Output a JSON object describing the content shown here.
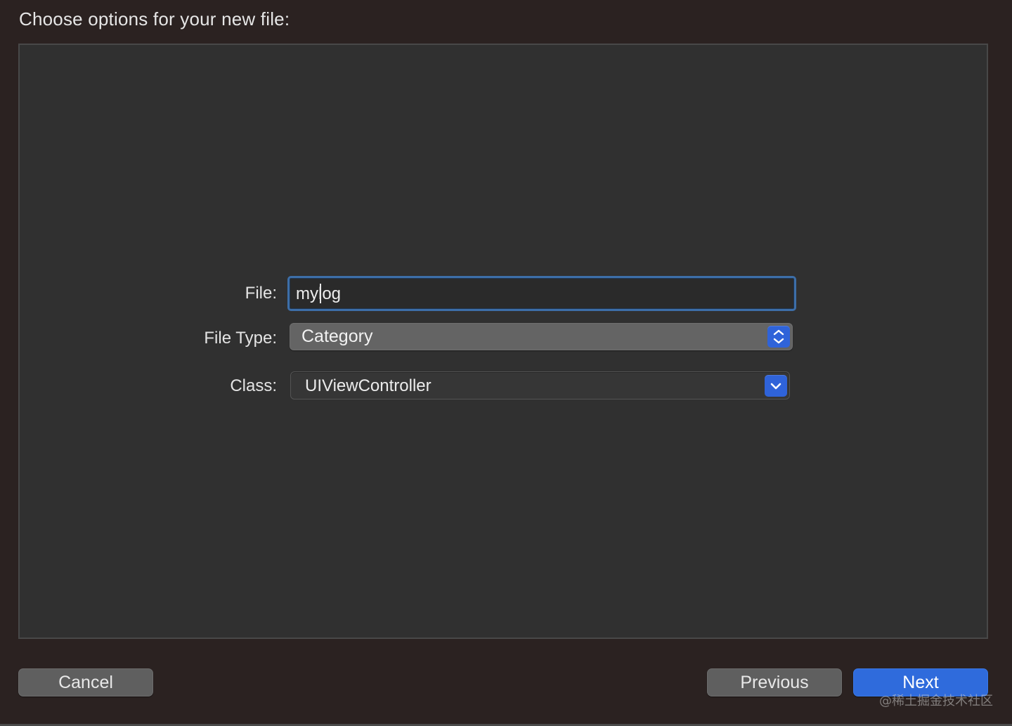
{
  "dialog": {
    "heading": "Choose options for your new file:"
  },
  "form": {
    "file_label": "File:",
    "file_value": "mylog",
    "file_type_label": "File Type:",
    "file_type_value": "Category",
    "class_label": "Class:",
    "class_value": "UIViewController"
  },
  "buttons": {
    "cancel": "Cancel",
    "previous": "Previous",
    "next": "Next"
  },
  "watermark": "@稀土掘金技术社区",
  "icons": {
    "file_type_control": "up-down-chevron-icon",
    "class_control": "chevron-down-icon"
  },
  "colors": {
    "accent": "#2f63d9",
    "focus_ring": "#3d6ea8",
    "background": "#2b2221",
    "panel": "#303030"
  }
}
